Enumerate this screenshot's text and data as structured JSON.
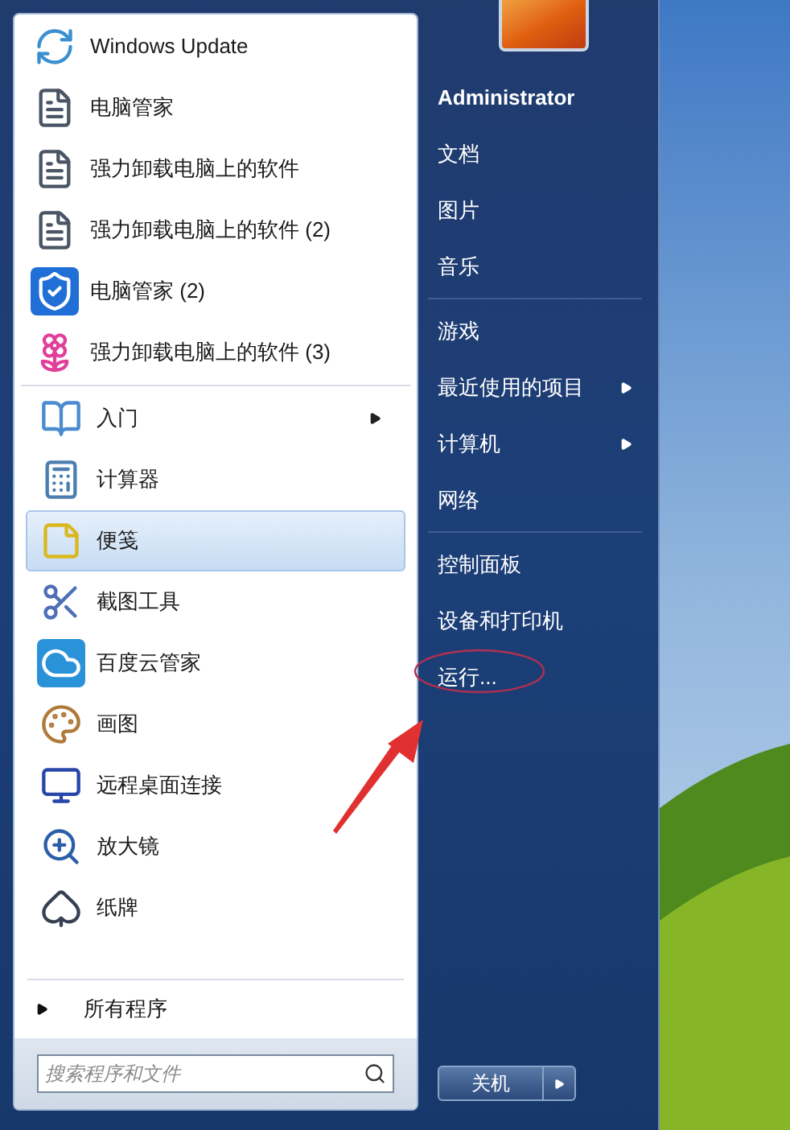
{
  "programs": {
    "groups": [
      [
        {
          "label": "Windows Update",
          "selected": false,
          "has_submenu": false
        },
        {
          "label": "电脑管家",
          "selected": false,
          "has_submenu": false
        },
        {
          "label": "强力卸载电脑上的软件",
          "selected": false,
          "has_submenu": false
        },
        {
          "label": "强力卸载电脑上的软件 (2)",
          "selected": false,
          "has_submenu": false
        },
        {
          "label": "电脑管家 (2)",
          "selected": false,
          "has_submenu": false
        },
        {
          "label": "强力卸载电脑上的软件 (3)",
          "selected": false,
          "has_submenu": false
        }
      ],
      [
        {
          "label": "入门",
          "selected": false,
          "has_submenu": true
        },
        {
          "label": "计算器",
          "selected": false,
          "has_submenu": false
        },
        {
          "label": "便笺",
          "selected": true,
          "has_submenu": false
        },
        {
          "label": "截图工具",
          "selected": false,
          "has_submenu": false
        },
        {
          "label": "百度云管家",
          "selected": false,
          "has_submenu": false
        },
        {
          "label": "画图",
          "selected": false,
          "has_submenu": false
        },
        {
          "label": "远程桌面连接",
          "selected": false,
          "has_submenu": false
        },
        {
          "label": "放大镜",
          "selected": false,
          "has_submenu": false
        },
        {
          "label": "纸牌",
          "selected": false,
          "has_submenu": false
        }
      ]
    ],
    "all_programs": "所有程序"
  },
  "search": {
    "placeholder": "搜索程序和文件"
  },
  "places": {
    "groups": [
      [
        {
          "label": "Administrator",
          "has_submenu": false
        },
        {
          "label": "文档",
          "has_submenu": false
        },
        {
          "label": "图片",
          "has_submenu": false
        },
        {
          "label": "音乐",
          "has_submenu": false
        }
      ],
      [
        {
          "label": "游戏",
          "has_submenu": false
        },
        {
          "label": "最近使用的项目",
          "has_submenu": true
        },
        {
          "label": "计算机",
          "has_submenu": true
        },
        {
          "label": "网络",
          "has_submenu": false
        }
      ],
      [
        {
          "label": "控制面板",
          "has_submenu": false
        },
        {
          "label": "设备和打印机",
          "has_submenu": false
        },
        {
          "label": "运行...",
          "has_submenu": false
        }
      ]
    ]
  },
  "shutdown": {
    "label": "关机"
  }
}
